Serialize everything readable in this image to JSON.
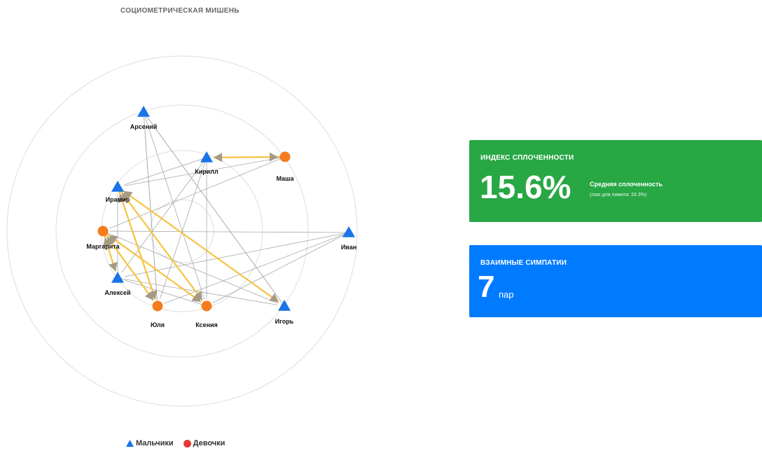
{
  "chart_title": "СОЦИОМЕТРИЧЕСКАЯ МИШЕНЬ",
  "colors": {
    "boy": "#1a73e8",
    "girl": "#f57c1f",
    "mutual_edge": "#f5c342",
    "edge": "#a8a8a8",
    "ring": "#dddddd",
    "card_green": "#28a745",
    "card_blue": "#007bff"
  },
  "nodes": [
    {
      "id": "arseniy",
      "label": "Арсений",
      "gender": "boy"
    },
    {
      "id": "kirill",
      "label": "Кирилл",
      "gender": "boy"
    },
    {
      "id": "masha",
      "label": "Маша",
      "gender": "girl"
    },
    {
      "id": "iramir",
      "label": "Ирамир",
      "gender": "boy"
    },
    {
      "id": "margarita",
      "label": "Маргарита",
      "gender": "girl"
    },
    {
      "id": "ivan",
      "label": "Иван",
      "gender": "boy"
    },
    {
      "id": "aleksey",
      "label": "Алексей",
      "gender": "boy"
    },
    {
      "id": "yulya",
      "label": "Юля",
      "gender": "girl"
    },
    {
      "id": "kseniya",
      "label": "Ксения",
      "gender": "girl"
    },
    {
      "id": "igor",
      "label": "Игорь",
      "gender": "boy"
    }
  ],
  "edges": [
    {
      "from": "arseniy",
      "to": "yulya",
      "mutual": false
    },
    {
      "from": "arseniy",
      "to": "kseniya",
      "mutual": false
    },
    {
      "from": "arseniy",
      "to": "igor",
      "mutual": false
    },
    {
      "from": "kirill",
      "to": "iramir",
      "mutual": false
    },
    {
      "from": "kirill",
      "to": "aleksey",
      "mutual": false
    },
    {
      "from": "kirill",
      "to": "yulya",
      "mutual": false
    },
    {
      "from": "kirill",
      "to": "kseniya",
      "mutual": false
    },
    {
      "from": "masha",
      "to": "kirill",
      "mutual": true
    },
    {
      "from": "masha",
      "to": "iramir",
      "mutual": false
    },
    {
      "from": "masha",
      "to": "margarita",
      "mutual": false
    },
    {
      "from": "iramir",
      "to": "yulya",
      "mutual": true
    },
    {
      "from": "iramir",
      "to": "kseniya",
      "mutual": true
    },
    {
      "from": "iramir",
      "to": "igor",
      "mutual": true
    },
    {
      "from": "margarita",
      "to": "aleksey",
      "mutual": true
    },
    {
      "from": "margarita",
      "to": "yulya",
      "mutual": true
    },
    {
      "from": "margarita",
      "to": "kseniya",
      "mutual": true
    },
    {
      "from": "margarita",
      "to": "igor",
      "mutual": false
    },
    {
      "from": "ivan",
      "to": "margarita",
      "mutual": false
    },
    {
      "from": "ivan",
      "to": "aleksey",
      "mutual": false
    },
    {
      "from": "ivan",
      "to": "yulya",
      "mutual": false
    },
    {
      "from": "ivan",
      "to": "kseniya",
      "mutual": false
    },
    {
      "from": "aleksey",
      "to": "iramir",
      "mutual": false
    },
    {
      "from": "aleksey",
      "to": "igor",
      "mutual": false
    },
    {
      "from": "yulya",
      "to": "arseniy",
      "mutual": false
    },
    {
      "from": "kseniya",
      "to": "aleksey",
      "mutual": false
    },
    {
      "from": "igor",
      "to": "arseniy",
      "mutual": false
    }
  ],
  "legend": {
    "boys_label": "Мальчики",
    "girls_label": "Девочки"
  },
  "cohesion_card": {
    "header": "ИНДЕКС СПЛОЧЕННОСТИ",
    "value": "15.6%",
    "description": "Средняя сплоченность",
    "note": "(max для лимита: 33.3%)"
  },
  "mutual_card": {
    "header": "ВЗАИМНЫЕ СИМПАТИИ",
    "value": "7",
    "unit": "пар"
  }
}
